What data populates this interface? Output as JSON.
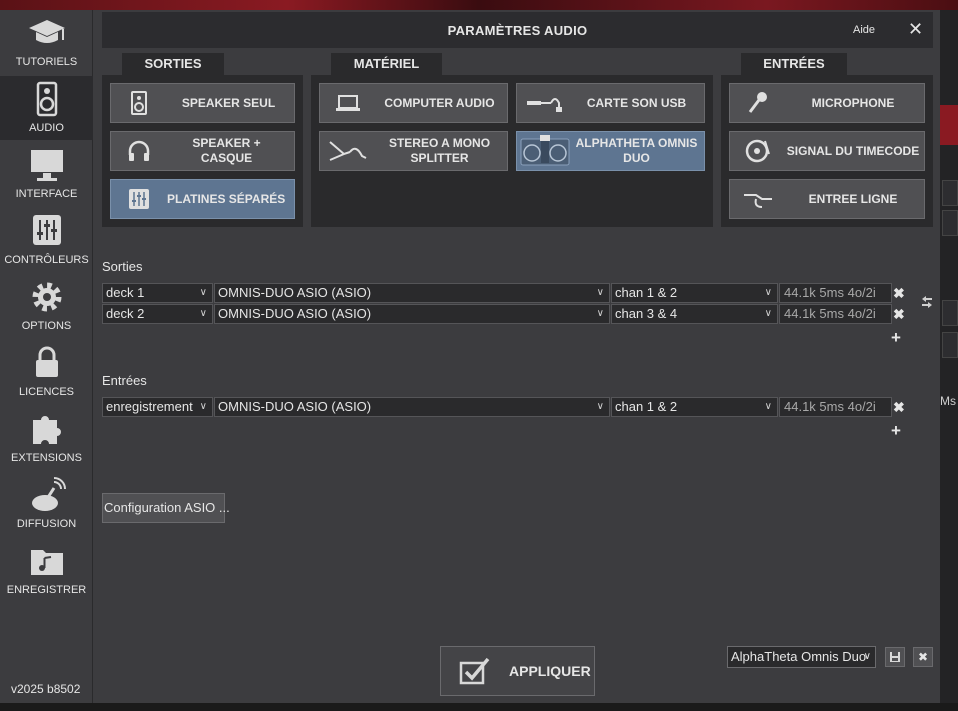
{
  "sidebar": {
    "items": [
      {
        "label": "TUTORIELS",
        "icon": "graduation-cap-icon"
      },
      {
        "label": "AUDIO",
        "icon": "speaker-icon"
      },
      {
        "label": "INTERFACE",
        "icon": "monitor-icon"
      },
      {
        "label": "CONTRÔLEURS",
        "icon": "sliders-icon"
      },
      {
        "label": "OPTIONS",
        "icon": "gear-icon"
      },
      {
        "label": "LICENCES",
        "icon": "lock-icon"
      },
      {
        "label": "EXTENSIONS",
        "icon": "puzzle-icon"
      },
      {
        "label": "DIFFUSION",
        "icon": "broadcast-dish-icon"
      },
      {
        "label": "ENREGISTRER",
        "icon": "music-folder-icon"
      }
    ],
    "active": "AUDIO",
    "version": "v2025 b8502"
  },
  "dialog": {
    "title": "PARAMÈTRES AUDIO",
    "help": "Aide",
    "close": "✕"
  },
  "groups": {
    "sorties": {
      "tab": "SORTIES",
      "buttons": [
        {
          "label": "SPEAKER SEUL",
          "icon": "speaker-icon",
          "selected": false
        },
        {
          "label": "SPEAKER + CASQUE",
          "icon": "headphones-icon",
          "selected": false
        },
        {
          "label": "PLATINES SÉPARÉS",
          "icon": "sliders-icon",
          "selected": true
        }
      ]
    },
    "materiel": {
      "tab": "MATÉRIEL",
      "buttons": [
        {
          "label": "COMPUTER AUDIO",
          "icon": "laptop-icon",
          "selected": false
        },
        {
          "label": "CARTE SON USB",
          "icon": "usb-cable-icon",
          "selected": false
        },
        {
          "label": "STEREO A MONO SPLITTER",
          "icon": "splitter-cable-icon",
          "selected": false
        },
        {
          "label": "ALPHATHETA OMNIS DUO",
          "icon": "dj-controller-icon",
          "selected": true
        }
      ]
    },
    "entrees": {
      "tab": "ENTRÉES",
      "buttons": [
        {
          "label": "MICROPHONE",
          "icon": "microphone-icon",
          "selected": false
        },
        {
          "label": "SIGNAL DU TIMECODE",
          "icon": "vinyl-icon",
          "selected": false
        },
        {
          "label": "ENTREE LIGNE",
          "icon": "jack-cable-icon",
          "selected": false
        }
      ]
    }
  },
  "outputs": {
    "label": "Sorties",
    "rows": [
      {
        "target": "deck 1",
        "device": "OMNIS-DUO ASIO (ASIO)",
        "channel": "chan 1 & 2",
        "info": "44.1k 5ms 4o/2i"
      },
      {
        "target": "deck 2",
        "device": "OMNIS-DUO ASIO (ASIO)",
        "channel": "chan 3 & 4",
        "info": "44.1k 5ms 4o/2i"
      }
    ],
    "remove": "✖",
    "add": "+"
  },
  "inputs": {
    "label": "Entrées",
    "rows": [
      {
        "target": "enregistrement",
        "device": "OMNIS-DUO ASIO (ASIO)",
        "channel": "chan 1 & 2",
        "info": "44.1k 5ms 4o/2i"
      }
    ],
    "remove": "✖",
    "add": "+"
  },
  "asio_button": "Configuration ASIO ...",
  "apply_button": "APPLIQUER",
  "preset": {
    "value": "AlphaTheta Omnis Duo"
  },
  "background_right_text": "Ms",
  "colors": {
    "selected_button": "#5e7591",
    "panel_dark": "#2a2a2c",
    "dialog_bg": "#3c3c3f",
    "accent_red": "#8a1a22"
  }
}
